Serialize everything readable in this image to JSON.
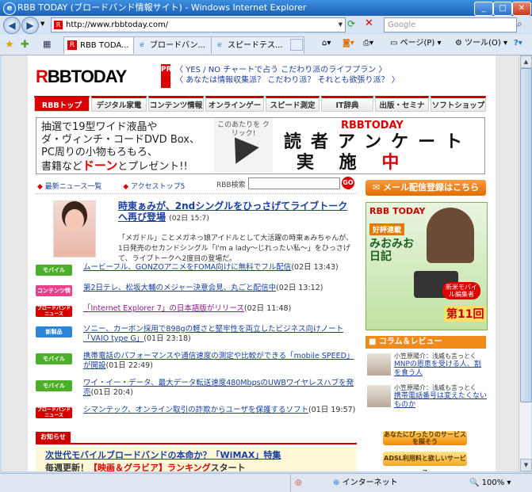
{
  "window": {
    "title": "RBB TODAY (ブロードバンド情報サイト) - Windows Internet Explorer"
  },
  "toolbar": {
    "url": "http://www.rbbtoday.com/",
    "search_placeholder": "Google",
    "page_menu": "ページ(P)",
    "tools_menu": "ツール(O)"
  },
  "tabs": [
    {
      "label": "RBB TODA..."
    },
    {
      "label": "ブロードバン..."
    },
    {
      "label": "スピードテス..."
    }
  ],
  "site": {
    "logo_r": "R",
    "logo_rest": "BBTODAY",
    "pr_badge": "PR",
    "pr_links": [
      "YES / NO チャートで占う こだわり派のライフプラン",
      "あなたは情報収集派？ こだわり派？ それとも欲張り派？"
    ],
    "nav": [
      "RBBトップ",
      "デジタル家電",
      "コンテンツ情報",
      "オンラインゲーム",
      "スピード測定",
      "IT辞典",
      "出版・セミナー",
      "ソフトショップ"
    ],
    "banner": {
      "line1": "抽選で19型ワイド液晶や",
      "line2": "ダ・ヴィンチ・コードDVD Box、",
      "line3": "PC周りの小物もろもろ、",
      "line4a": "書籍など",
      "line4b": "ドーン",
      "line4c": "とプレゼント!!",
      "click": "このあたりを クリック!",
      "brand": "RBBTODAY",
      "title1": "読者アンケート",
      "title2": "実 施 ",
      "title3": "中"
    },
    "links": {
      "latest": "最新ニュース一覧",
      "access": "アクセストップ5"
    },
    "search_label": "RBB検索",
    "go": "GO",
    "top_story": {
      "headline": "時東ぁみが、2ndシングルをひっさげてライブトークへ再び登場",
      "date": "(02日 15:7)",
      "summary": "「メガドル」ことメガネっ娘アイドルとして大活躍の時東ぁみちゃんが、1日発売のセカンドシングル「I'm a lady〜じれったい私〜」をひっさげて、ライブトークへ2度目の登場だ。"
    },
    "news": [
      {
        "cat": "モバイル",
        "color": "#4caf2a",
        "link": "ムービーフル、GONZOアニメをFOMA向けに無料でフル配信",
        "date": "(02日 13:43)"
      },
      {
        "cat": "コンテンツ情報",
        "color": "#e8408a",
        "link": "第2日テレ、松坂大輔のメジャー決意会見、丸ごと配信中",
        "date": "(02日 13:12)"
      },
      {
        "cat": "ブロードバンドニュース",
        "color": "#d40000",
        "link": "「Internet Explorer 7」の日本語版がリリース",
        "date": "(02日 11:48)"
      },
      {
        "cat": "新製品",
        "color": "#2b84d6",
        "link": "ソニー、カーボン採用で898gの軽さと堅牢性を両立したビジネス向けノート「VAIO type G」",
        "date": "(01日 23:18)"
      },
      {
        "cat": "モバイル",
        "color": "#4caf2a",
        "link": "携帯電話のパフォーマンスや通信速度の測定や比較ができる「mobile SPEED」が開設",
        "date": "(01日 22:49)"
      },
      {
        "cat": "モバイル",
        "color": "#4caf2a",
        "link": "ワイ・イー・データ、最大データ転送速度480MbpsのUWBワイヤレスハブを発売",
        "date": "(01日 20:4)"
      },
      {
        "cat": "ブロードバンドニュース",
        "color": "#d40000",
        "link": "シマンテック、オンライン取引の詐欺からユーザを保護するソフト",
        "date": "(01日 19:57)"
      }
    ],
    "notice": {
      "header": "お知らせ",
      "line1": "次世代モバイルブロードバンドの本命か？「WiMAX」特集",
      "line2a": "毎週更新！",
      "line2b": "【映画＆グラビア】ランキング",
      "line2c": "スタート"
    },
    "sidebar": {
      "mail_btn": "メール配信登録はこちら",
      "ad_brand": "RBB TODAY",
      "ad_tag": "好評連載",
      "ad_title": "みおみお日記",
      "ad_badge": "新米モバイル編集者",
      "ad_issue": "第11回",
      "column_header": "コラム＆レビュー",
      "columns": [
        {
          "author": "小笠原陽介：浅威も言っとく",
          "title": "MNPの恩恵を受ける人、割を食う人"
        },
        {
          "author": "小笠原陽介：浅威も言っとく",
          "title": "携帯電話番号は変えたくないものか"
        }
      ],
      "btn1": "あなたにぴったりのサービスを探そう",
      "btn2": "ADSL利用料と欲しいサービス"
    }
  },
  "statusbar": {
    "zone": "インターネット",
    "zoom": "100%"
  }
}
